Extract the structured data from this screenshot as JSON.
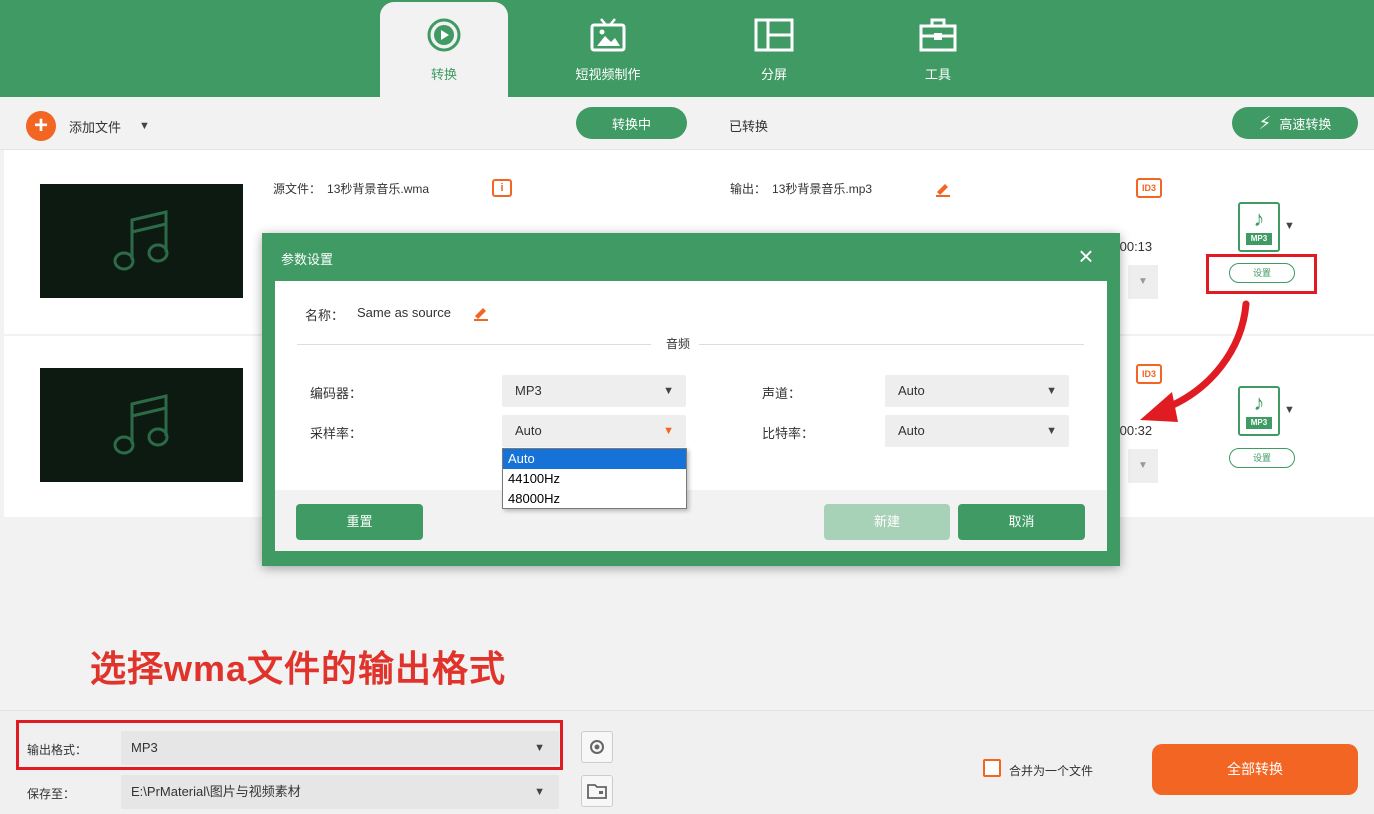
{
  "nav": {
    "tabs": [
      {
        "label": "转换",
        "icon": "convert-icon",
        "active": true
      },
      {
        "label": "短视频制作",
        "icon": "tv-icon",
        "active": false
      },
      {
        "label": "分屏",
        "icon": "split-screen-icon",
        "active": false
      },
      {
        "label": "工具",
        "icon": "toolbox-icon",
        "active": false
      }
    ]
  },
  "toolbar": {
    "add_file_label": "添加文件",
    "converting_label": "转换中",
    "converted_label": "已转换",
    "fast_convert_label": "高速转换"
  },
  "files": [
    {
      "source_label": "源文件：",
      "source_name": "13秒背景音乐.wma",
      "output_label": "输出：",
      "output_name": "13秒背景音乐.mp3",
      "duration": ":00:13",
      "format_tag": "MP3",
      "settings_label": "设置",
      "id3": "ID3"
    },
    {
      "duration": ":00:32",
      "format_tag": "MP3",
      "settings_label": "设置",
      "id3": "ID3"
    }
  ],
  "dialog": {
    "title": "参数设置",
    "close_glyph": "×",
    "name_label": "名称：",
    "name_value": "Same as source",
    "section_title": "音频",
    "encoder_label": "编码器：",
    "encoder_value": "MP3",
    "channel_label": "声道：",
    "channel_value": "Auto",
    "samplerate_label": "采样率：",
    "samplerate_value": "Auto",
    "bitrate_label": "比特率：",
    "bitrate_value": "Auto",
    "samplerate_options": [
      "Auto",
      "44100Hz",
      "48000Hz"
    ],
    "reset_label": "重置",
    "new_label": "新建",
    "cancel_label": "取消"
  },
  "caption": "选择wma文件的输出格式",
  "bottom": {
    "output_format_label": "输出格式：",
    "output_format_value": "MP3",
    "save_to_label": "保存至：",
    "save_to_value": "E:\\PrMaterial\\图片与视频素材",
    "merge_label": "合并为一个文件",
    "convert_all_label": "全部转换"
  },
  "colors": {
    "brand_green": "#3f9a64",
    "accent_orange": "#f26522",
    "highlight_red": "#e01b22",
    "selection_blue": "#1672d6"
  }
}
